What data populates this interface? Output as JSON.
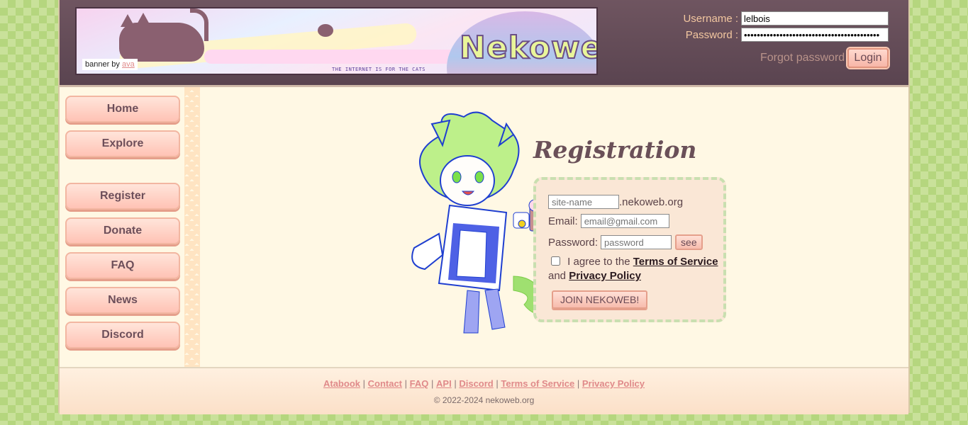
{
  "banner": {
    "credit_prefix": "banner by",
    "credit_link": "ava",
    "logo": "Nekoweb",
    "tagline": "THE INTERNET IS FOR THE CATS"
  },
  "login": {
    "username_label": "Username :",
    "username_value": "lelbois",
    "password_label": "Password :",
    "password_value": "••••••••••••••••••••••••••••••••••••••••••",
    "forgot": "Forgot password",
    "login_button": "Login"
  },
  "sidebar": {
    "items": [
      {
        "label": "Home"
      },
      {
        "label": "Explore"
      },
      {
        "label": "Register"
      },
      {
        "label": "Donate"
      },
      {
        "label": "FAQ"
      },
      {
        "label": "News"
      },
      {
        "label": "Discord"
      }
    ]
  },
  "registration": {
    "title": "Registration",
    "site_placeholder": "site-name",
    "site_suffix": ".nekoweb.org",
    "email_label": "Email:",
    "email_placeholder": "email@gmail.com",
    "password_label": "Password:",
    "password_placeholder": "password",
    "see_button": "see",
    "agree_text": "I agree to the",
    "terms_link": "Terms of Service",
    "and_text": "and",
    "privacy_link": "Privacy Policy",
    "join_button": "JOIN NEKOWEB!"
  },
  "footer": {
    "links": [
      "Atabook",
      "Contact",
      "FAQ",
      "API",
      "Discord",
      "Terms of Service",
      "Privacy Policy"
    ],
    "separator": "|",
    "copyright": "© 2022-2024 nekoweb.org"
  }
}
